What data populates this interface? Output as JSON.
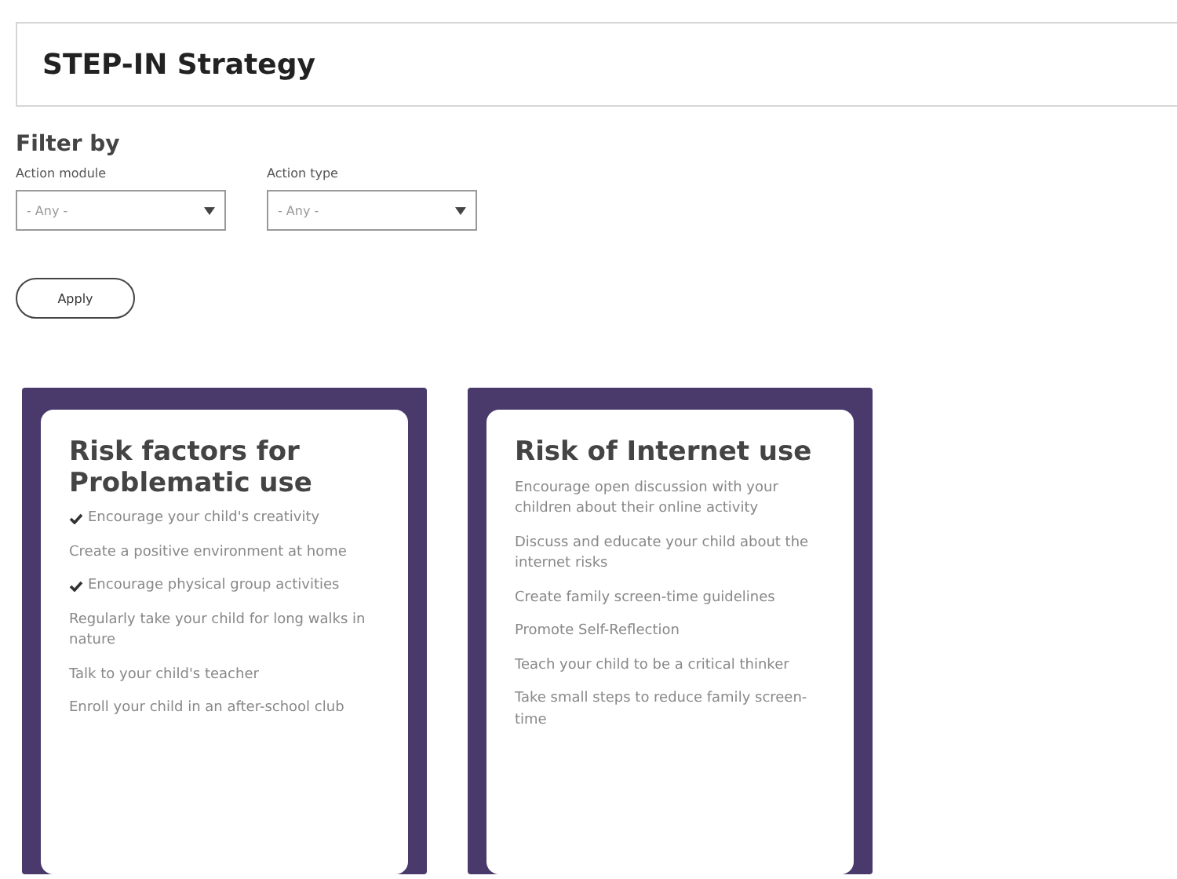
{
  "header": {
    "title": "STEP-IN Strategy"
  },
  "filter": {
    "heading": "Filter by",
    "fields": [
      {
        "label": "Action module",
        "value": "- Any -"
      },
      {
        "label": "Action type",
        "value": "- Any -"
      }
    ],
    "apply": "Apply"
  },
  "cards": [
    {
      "title": "Risk factors for Problematic use",
      "items": [
        {
          "text": "Encourage your child's creativity",
          "checked": true
        },
        {
          "text": "Create a positive environment at home",
          "checked": false
        },
        {
          "text": "Encourage physical group activities",
          "checked": true
        },
        {
          "text": "Regularly take your child for long walks in nature",
          "checked": false
        },
        {
          "text": "Talk to your child's teacher",
          "checked": false
        },
        {
          "text": "Enroll your child in an after-school club",
          "checked": false
        }
      ]
    },
    {
      "title": "Risk of Internet use",
      "items": [
        {
          "text": "Encourage open discussion with your children about their online activity",
          "checked": false
        },
        {
          "text": "Discuss and educate your child about the internet risks",
          "checked": false
        },
        {
          "text": "Create family screen-time guidelines",
          "checked": false
        },
        {
          "text": "Promote Self-Reflection",
          "checked": false
        },
        {
          "text": "Teach your child to be a critical thinker",
          "checked": false
        },
        {
          "text": "Take small steps to reduce family screen-time",
          "checked": false
        }
      ]
    }
  ]
}
